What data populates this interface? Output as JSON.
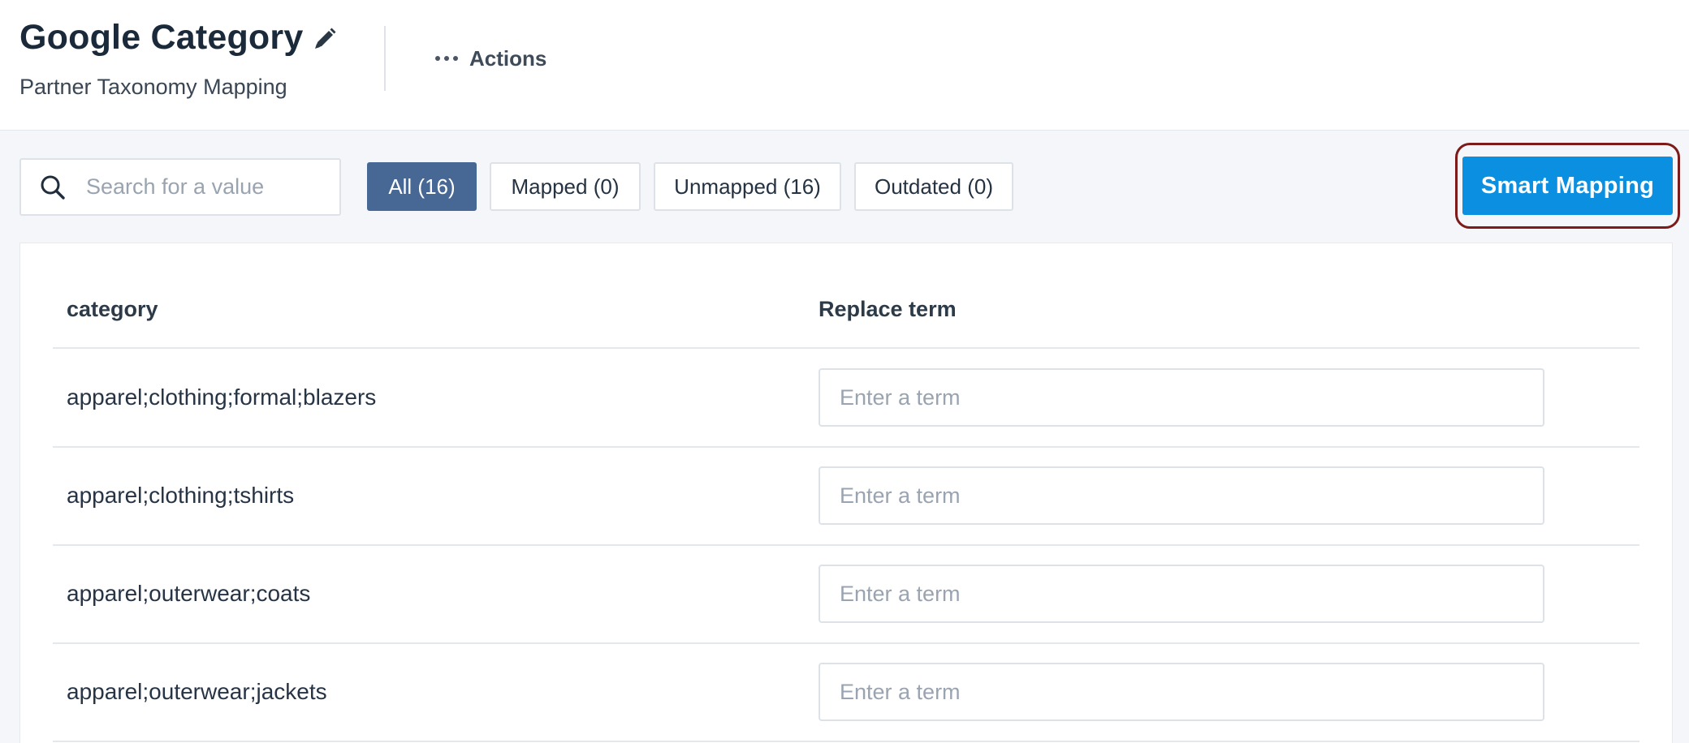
{
  "header": {
    "title": "Google Category",
    "subtitle": "Partner Taxonomy Mapping",
    "actions_label": "Actions"
  },
  "toolbar": {
    "search_placeholder": "Search for a value",
    "filters": [
      {
        "label": "All (16)",
        "active": true
      },
      {
        "label": "Mapped (0)",
        "active": false
      },
      {
        "label": "Unmapped (16)",
        "active": false
      },
      {
        "label": "Outdated (0)",
        "active": false
      }
    ],
    "smart_mapping_label": "Smart Mapping"
  },
  "table": {
    "columns": [
      "category",
      "Replace term"
    ],
    "input_placeholder": "Enter a term",
    "rows": [
      {
        "category": "apparel;clothing;formal;blazers",
        "term": ""
      },
      {
        "category": "apparel;clothing;tshirts",
        "term": ""
      },
      {
        "category": "apparel;outerwear;coats",
        "term": ""
      },
      {
        "category": "apparel;outerwear;jackets",
        "term": ""
      }
    ]
  },
  "colors": {
    "accent": "#0b8fe0",
    "active_filter": "#476794",
    "highlight_ring": "#7d1a1a"
  }
}
